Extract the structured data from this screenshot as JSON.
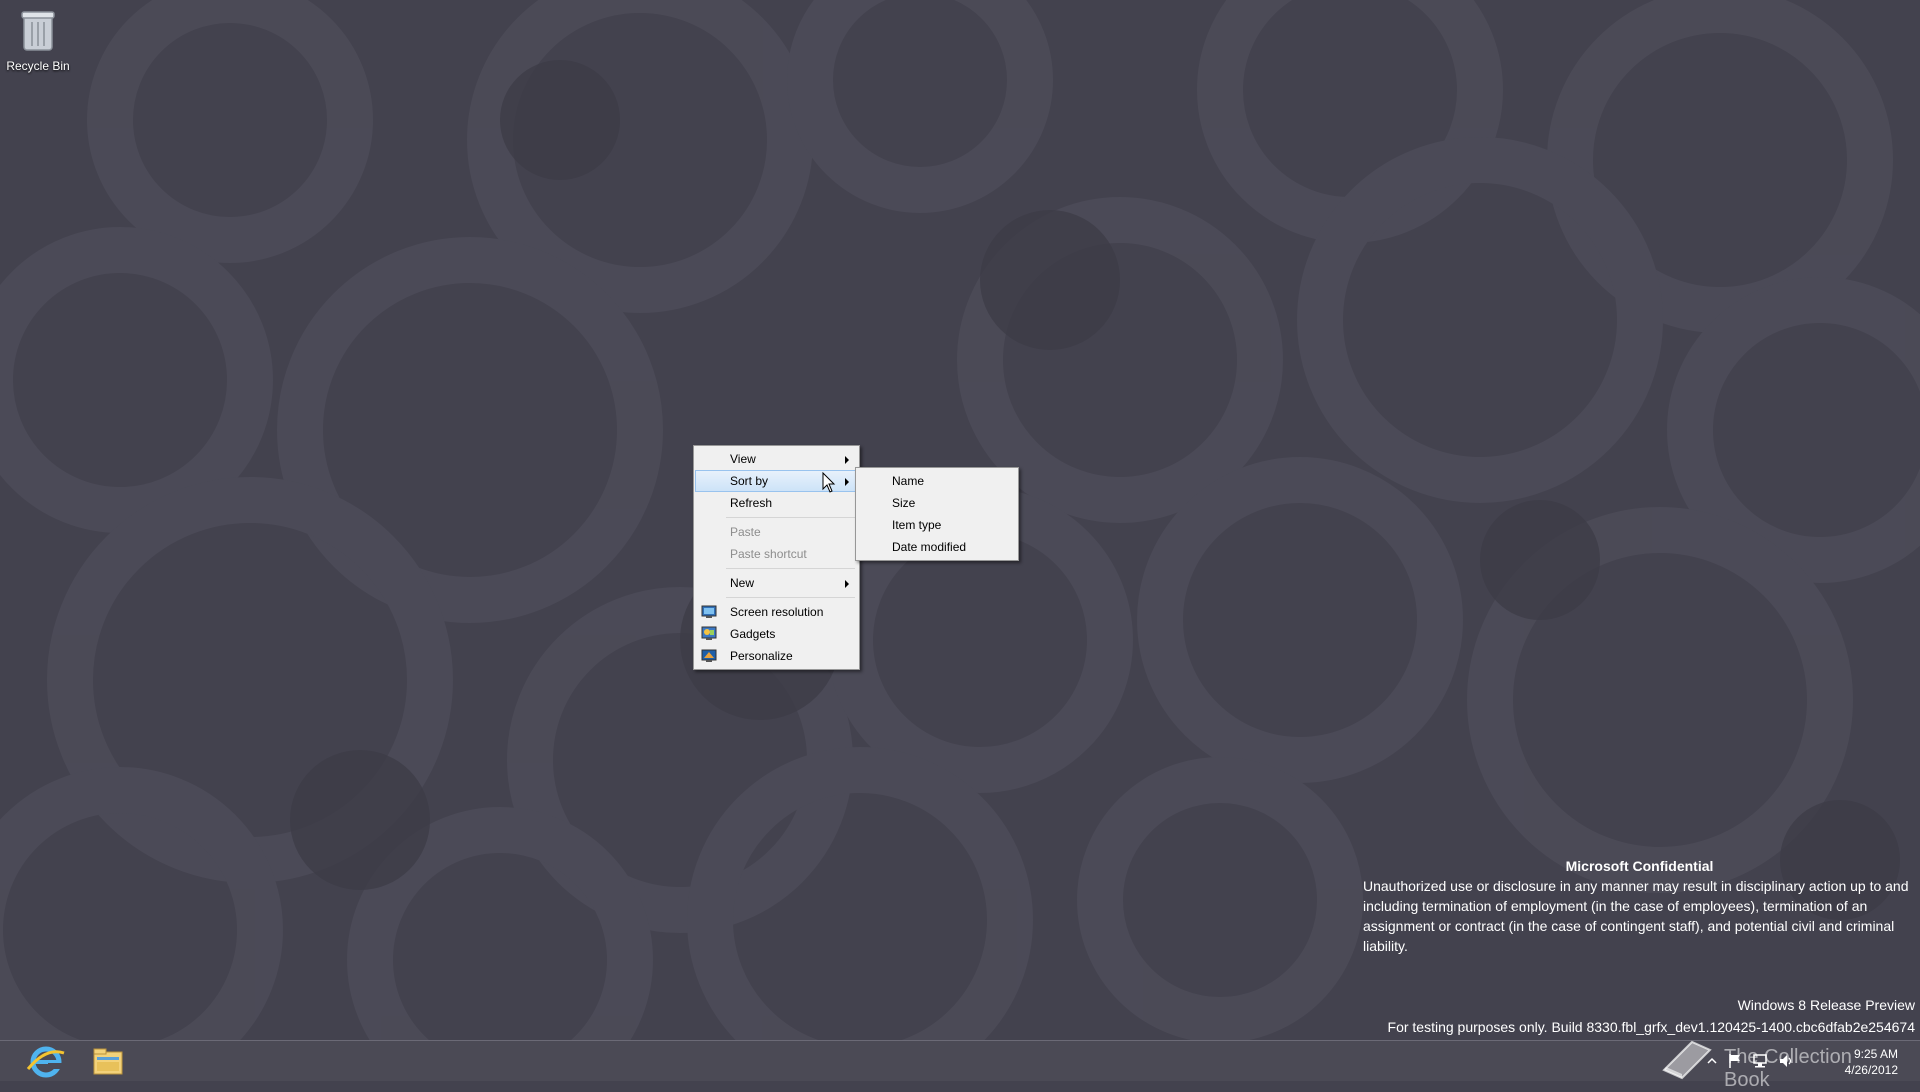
{
  "desktop": {
    "icons": [
      {
        "label": "Recycle Bin",
        "icon": "recycle-bin-icon"
      }
    ]
  },
  "context_menu": {
    "items": [
      {
        "label": "View",
        "submenu": true,
        "enabled": true
      },
      {
        "label": "Sort by",
        "submenu": true,
        "enabled": true,
        "highlighted": true
      },
      {
        "label": "Refresh",
        "enabled": true
      },
      {
        "label": "Paste",
        "enabled": false
      },
      {
        "label": "Paste shortcut",
        "enabled": false
      },
      {
        "label": "New",
        "submenu": true,
        "enabled": true
      },
      {
        "label": "Screen resolution",
        "icon": "screen-resolution-icon",
        "enabled": true
      },
      {
        "label": "Gadgets",
        "icon": "gadgets-icon",
        "enabled": true
      },
      {
        "label": "Personalize",
        "icon": "personalize-icon",
        "enabled": true
      }
    ]
  },
  "sort_submenu": {
    "items": [
      {
        "label": "Name"
      },
      {
        "label": "Size"
      },
      {
        "label": "Item type"
      },
      {
        "label": "Date modified"
      }
    ]
  },
  "confidential": {
    "title": "Microsoft Confidential",
    "body": "Unauthorized use or disclosure in any manner may result in disciplinary action up to and including termination of employment (in the case of employees), termination of an assignment or contract (in the case of contingent staff), and potential civil and criminal liability."
  },
  "build": {
    "edition": "Windows 8 Release Preview",
    "text": "For testing purposes only. Build 8330.fbl_grfx_dev1.120425-1400.cbc6dfab2e254674"
  },
  "taskbar": {
    "pinned": [
      {
        "name": "internet-explorer-icon"
      },
      {
        "name": "file-explorer-icon"
      }
    ],
    "clock_time": "9:25 AM",
    "clock_date": "4/26/2012"
  },
  "watermark": {
    "text": "The Collection Book"
  },
  "colors": {
    "background": "#43424e",
    "menu_bg": "#f0f0f0",
    "menu_highlight": "#cde3f8",
    "taskbar": "#4b4a55"
  }
}
